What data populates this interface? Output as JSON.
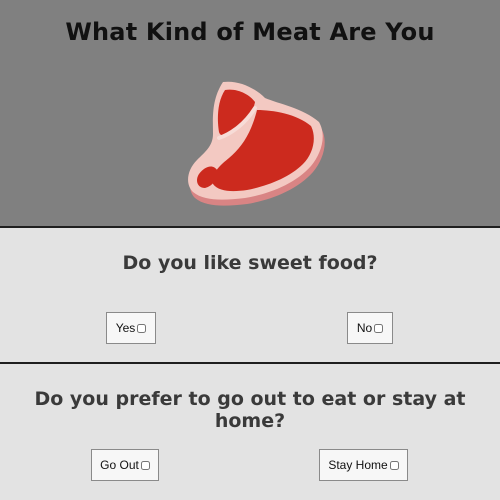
{
  "header": {
    "title": "What Kind of Meat Are You",
    "image_icon": "steak-icon",
    "background": "#808080"
  },
  "questions": [
    {
      "text": "Do you like sweet food?",
      "options": [
        {
          "label": "Yes",
          "checked": false
        },
        {
          "label": "No",
          "checked": false
        }
      ]
    },
    {
      "text": "Do you prefer to go out to eat or stay at home?",
      "options": [
        {
          "label": "Go Out",
          "checked": false
        },
        {
          "label": "Stay Home",
          "checked": false
        }
      ]
    }
  ],
  "colors": {
    "section_background": "#e3e3e3",
    "divider": "#1f1f1f",
    "steak_meat": "#cc2a1e",
    "steak_fat": "#f3c9c2"
  }
}
